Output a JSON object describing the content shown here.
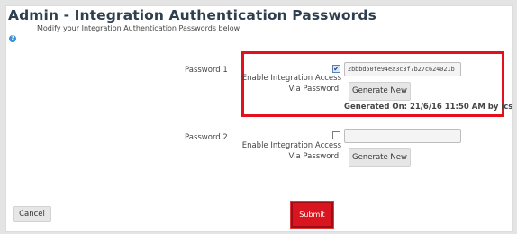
{
  "header": {
    "title": "Admin - Integration Authentication Passwords",
    "subtitle": "Modify your Integration Authentication Passwords below",
    "help_glyph": "?"
  },
  "password1": {
    "label": "Password 1",
    "enable_line1": "Enable Integration Access",
    "enable_line2": "Via Password:",
    "checked": true,
    "check_glyph": "✔",
    "value": "2bbbd50fe94ea3c3f7b27c624021b",
    "generate_label": "Generate New",
    "generated_on": "Generated On: 21/6/16 11:50 AM by ics"
  },
  "password2": {
    "label": "Password 2",
    "enable_line1": "Enable Integration Access",
    "enable_line2": "Via Password:",
    "checked": false,
    "value": "",
    "generate_label": "Generate New"
  },
  "footer": {
    "cancel_label": "Cancel",
    "submit_label": "Submit"
  },
  "colors": {
    "highlight": "#e3111d",
    "submit_bg": "#d9161f",
    "title": "#2f3f4f"
  },
  "icons": {
    "help": "help-icon"
  }
}
